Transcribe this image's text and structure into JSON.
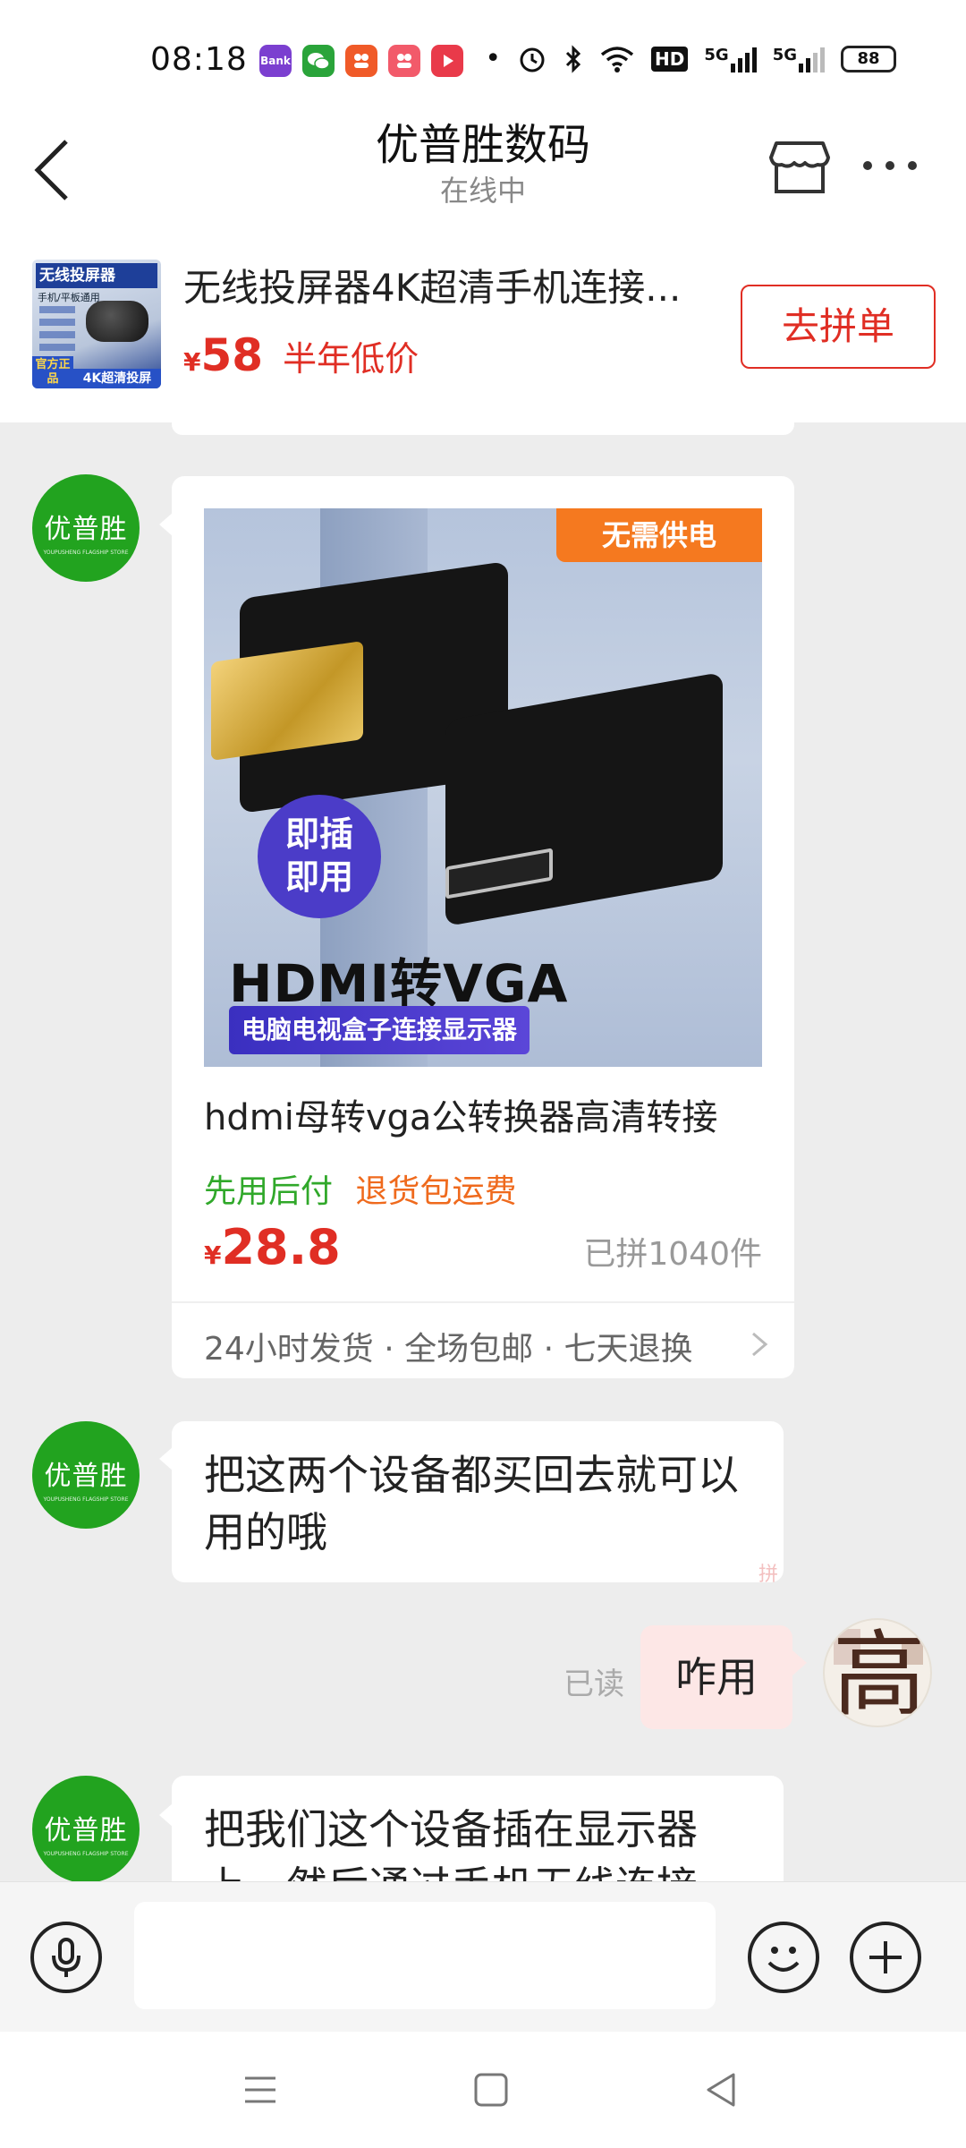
{
  "status_bar": {
    "time": "08:18",
    "network_labels": [
      "HD",
      "5G",
      "5G"
    ],
    "battery": "88",
    "app_icons": [
      {
        "name": "bank-app-icon",
        "color": "#7b3fd0",
        "text": "Bank"
      },
      {
        "name": "wechat-icon",
        "color": "#2aa43a",
        "text": ""
      },
      {
        "name": "app-orange-icon",
        "color": "#f05a28",
        "text": ""
      },
      {
        "name": "app-red-icon",
        "color": "#f25a6a",
        "text": ""
      },
      {
        "name": "video-app-icon",
        "color": "#e93a4a",
        "text": ""
      }
    ]
  },
  "header": {
    "title": "优普胜数码",
    "subtitle": "在线中"
  },
  "product_banner": {
    "title": "无线投屏器4K超清手机连接...",
    "currency": "¥",
    "price": "58",
    "tag": "半年低价",
    "button_label": "去拼单",
    "thumb": {
      "title": "无线投屏器",
      "sub": "手机/平板通用",
      "badge": "官方正品",
      "foot": "4K超清投屏"
    }
  },
  "chat": {
    "seller_avatar": {
      "name": "优普胜",
      "english": "YOUPUSHENG FLAGSHIP STORE"
    },
    "product_card": {
      "image": {
        "badge": "无需供电",
        "circle_text": "即插即用",
        "headline": "HDMI转VGA",
        "subline": "电脑电视盒子连接显示器"
      },
      "title": "hdmi母转vga公转换器高清转接",
      "tag_green": "先用后付",
      "tag_orange": "退货包运费",
      "currency": "¥",
      "price": "28.8",
      "sold": "已拼1040件",
      "footer": "24小时发货 · 全场包邮 · 七天退换"
    },
    "messages": [
      {
        "from": "seller",
        "text": "把这两个设备都买回去就可以用的哦",
        "stamp": "拼"
      },
      {
        "from": "me",
        "text": "咋用",
        "read": "已读"
      },
      {
        "from": "seller",
        "text": "把我们这个设备插在显示器上，然后通过手机无线连接"
      }
    ],
    "user_avatar": {
      "char": "高"
    }
  },
  "input_bar": {
    "placeholder": ""
  },
  "colors": {
    "accent_red": "#e02e24",
    "seller_green": "#22a31f",
    "chat_bg": "#ededed",
    "my_bubble": "#fde7e6"
  }
}
